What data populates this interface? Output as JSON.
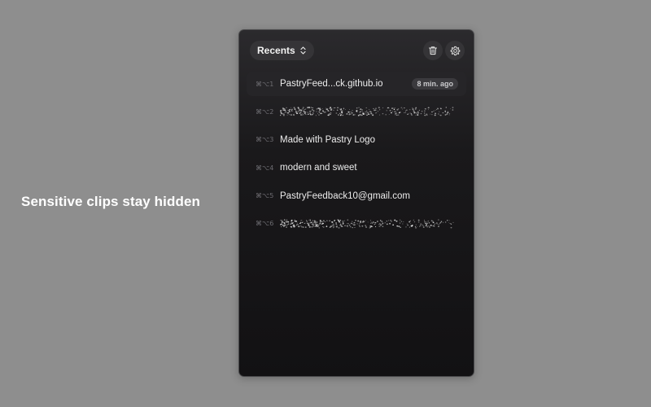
{
  "caption": "Sensitive clips stay hidden",
  "header": {
    "recents_label": "Recents",
    "recents_icon": "chevron-up-down-icon",
    "trash_icon": "trash-icon",
    "gear_icon": "gear-icon"
  },
  "clips": [
    {
      "shortcut": "⌘⌥1",
      "text": "PastryFeed...ck.github.io",
      "time": "8 min. ago",
      "hidden": false,
      "selected": true
    },
    {
      "shortcut": "⌘⌥2",
      "text": "",
      "hidden": true
    },
    {
      "shortcut": "⌘⌥3",
      "text": "Made with Pastry Logo",
      "hidden": false
    },
    {
      "shortcut": "⌘⌥4",
      "text": "modern and sweet",
      "hidden": false
    },
    {
      "shortcut": "⌘⌥5",
      "text": "PastryFeedback10@gmail.com",
      "hidden": false
    },
    {
      "shortcut": "⌘⌥6",
      "text": "",
      "hidden": true
    }
  ],
  "colors": {
    "background": "#8e8e8e",
    "panel": "#151416",
    "selected_row": "#262528",
    "text": "#ececec",
    "shortcut": "#6e6d72"
  }
}
